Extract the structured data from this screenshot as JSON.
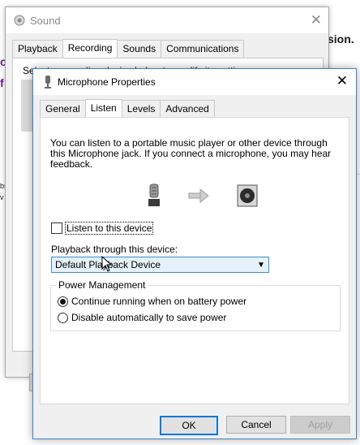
{
  "background": {
    "fragment_top": "sion.",
    "fragment_mid": "ol",
    "fragment_low": "v",
    "fragment_small": "bs"
  },
  "sound_window": {
    "title": "Sound",
    "tabs": [
      {
        "label": "Playback"
      },
      {
        "label": "Recording"
      },
      {
        "label": "Sounds"
      },
      {
        "label": "Communications"
      }
    ],
    "instruction": "Select a recording device below to modify its settings:"
  },
  "mic_window": {
    "title": "Microphone Properties",
    "tabs": [
      {
        "label": "General"
      },
      {
        "label": "Listen"
      },
      {
        "label": "Levels"
      },
      {
        "label": "Advanced"
      }
    ],
    "description": "You can listen to a portable music player or other device through this Microphone jack.  If you connect a microphone, you may hear feedback.",
    "listen_checkbox": {
      "label": "Listen to this device",
      "checked": false
    },
    "playback_label": "Playback through this device:",
    "playback_select": {
      "value": "Default Playback Device"
    },
    "power_group": {
      "legend": "Power Management",
      "options": [
        {
          "label": "Continue running when on battery power",
          "selected": true
        },
        {
          "label": "Disable automatically to save power",
          "selected": false
        }
      ]
    },
    "buttons": {
      "ok": "OK",
      "cancel": "Cancel",
      "apply": "Apply"
    }
  },
  "colors": {
    "accent": "#0078d7",
    "select_bg": "#e5f1fb",
    "window_border": "#3f82c6"
  },
  "icons": [
    "speaker-icon",
    "microphone-icon",
    "arrow-right-icon",
    "speaker-device-icon",
    "close-icon",
    "chevron-down-icon",
    "mouse-cursor-icon"
  ]
}
